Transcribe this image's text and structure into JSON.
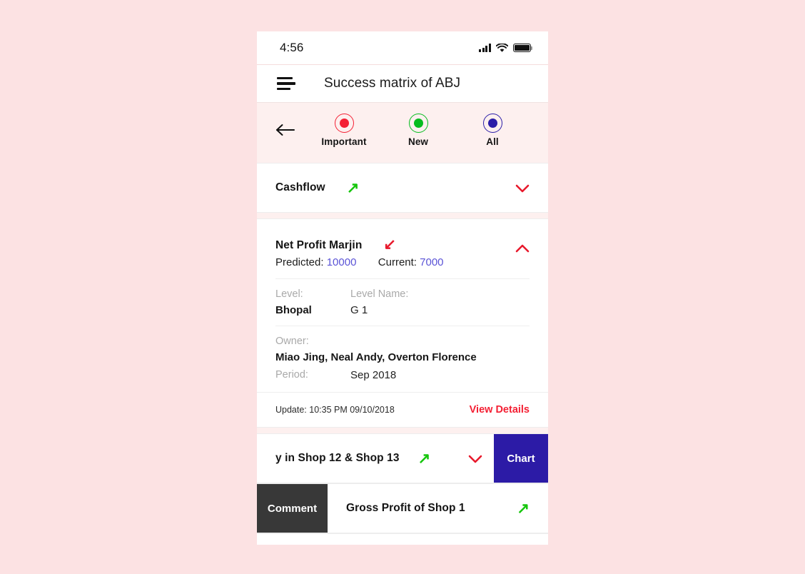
{
  "status_bar": {
    "time": "4:56",
    "signal_icon": "cellular-signal-icon",
    "wifi_icon": "wifi-icon",
    "battery_icon": "battery-full-icon"
  },
  "app_bar": {
    "menu_icon": "hamburger-menu-icon",
    "title": "Success matrix of ABJ"
  },
  "filter_tabs": {
    "back_icon": "back-arrow-icon",
    "items": [
      {
        "label": "Important",
        "color": "#f42034",
        "icon": "radio-dot-icon"
      },
      {
        "label": "New",
        "color": "#05bc1e",
        "icon": "radio-dot-icon"
      },
      {
        "label": "All",
        "color": "#2b1da8",
        "icon": "radio-dot-icon"
      }
    ]
  },
  "metrics": [
    {
      "title": "Cashflow",
      "trend": "↗",
      "trend_dir": "up",
      "chevron": "chevron-down-icon",
      "expanded": false
    },
    {
      "title": "Net Profit Marjin",
      "trend": "↙",
      "trend_dir": "down",
      "chevron": "chevron-up-icon",
      "expanded": true,
      "predicted_label": "Predicted:",
      "predicted_value": "10000",
      "current_label": "Current:",
      "current_value": "7000",
      "level_label": "Level:",
      "level_value": "Bhopal",
      "level_name_label": "Level Name:",
      "level_name_value": "G 1",
      "owner_label": "Owner:",
      "owner_value": "Miao Jing, Neal Andy, Overton Florence",
      "period_label": "Period:",
      "period_value": "Sep 2018",
      "update_text": "Update: 10:35 PM 09/10/2018",
      "view_details_label": "View Details"
    },
    {
      "title": "y in Shop 12 & Shop 13",
      "trend": "↗",
      "trend_dir": "up",
      "chevron": "chevron-down-icon",
      "expanded": false,
      "swipe_action": "Chart",
      "swipe_side": "right"
    },
    {
      "title": "Gross Profit of Shop 1",
      "trend": "↗",
      "trend_dir": "up",
      "expanded": false,
      "swipe_action": "Comment",
      "swipe_side": "left"
    }
  ],
  "colors": {
    "page_background": "#fce2e3",
    "strip_background": "#fdf0ef",
    "accent_red": "#f42034",
    "accent_green": "#16c60c",
    "accent_indigo": "#2c1ba6",
    "value_purple": "#5a53d6",
    "comment_dark": "#383838"
  }
}
